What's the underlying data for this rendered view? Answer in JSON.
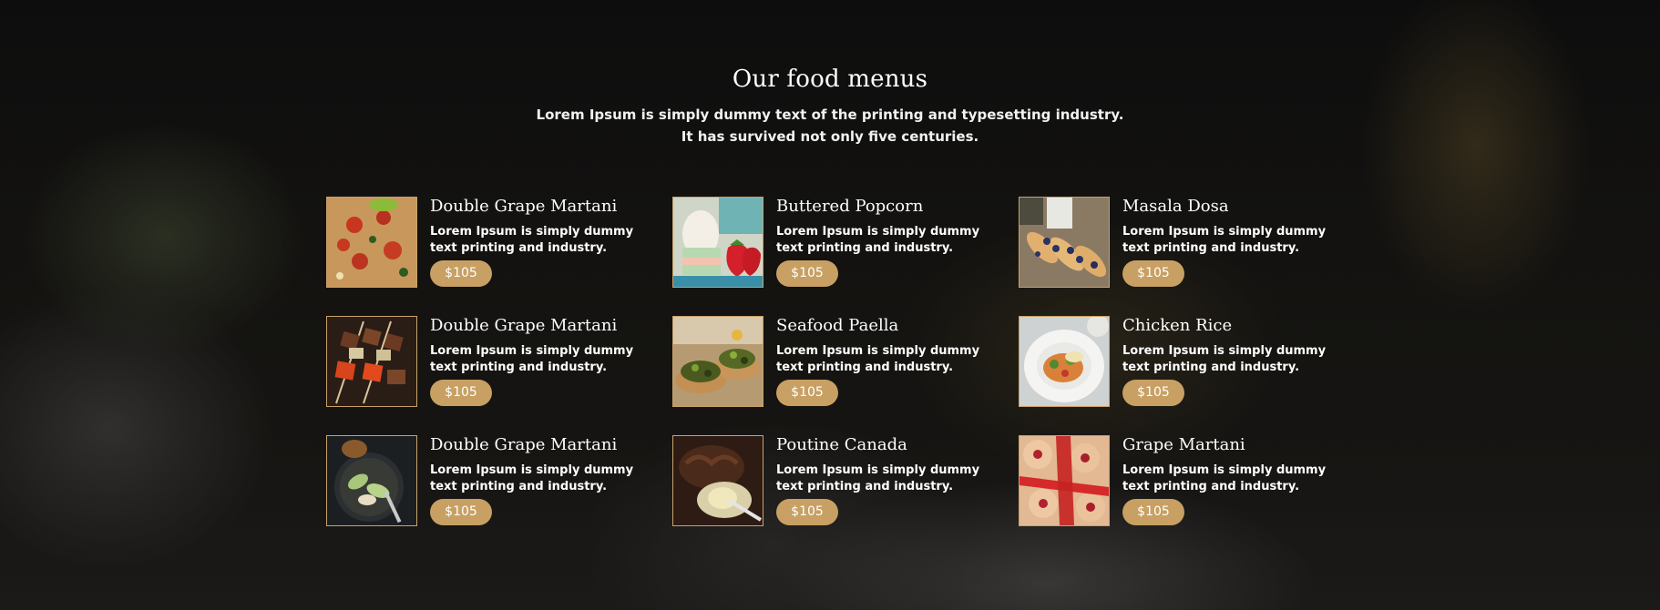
{
  "section": {
    "title": "Our food menus",
    "subtitle_line1": "Lorem Ipsum is simply dummy text of the printing and typesetting industry.",
    "subtitle_line2": "It has survived not only five centuries."
  },
  "colors": {
    "accent": "#c8a063",
    "thumb_border": "#c9a26b"
  },
  "menu_items": [
    {
      "name": "Double Grape Martani",
      "desc_line1": "Lorem Ipsum is simply dummy",
      "desc_line2": "text printing and industry.",
      "price": "$105",
      "image": "pizza-image"
    },
    {
      "name": "Buttered Popcorn",
      "desc_line1": "Lorem Ipsum is simply dummy",
      "desc_line2": "text printing and industry.",
      "price": "$105",
      "image": "strawberries-egg-image"
    },
    {
      "name": "Masala Dosa",
      "desc_line1": "Lorem Ipsum is simply dummy",
      "desc_line2": "text printing and industry.",
      "price": "$105",
      "image": "crepes-blueberries-image"
    },
    {
      "name": "Double Grape Martani",
      "desc_line1": "Lorem Ipsum is simply dummy",
      "desc_line2": "text printing and industry.",
      "price": "$105",
      "image": "kebab-skewers-image"
    },
    {
      "name": "Seafood Paella",
      "desc_line1": "Lorem Ipsum is simply dummy",
      "desc_line2": "text printing and industry.",
      "price": "$105",
      "image": "stuffed-mushrooms-image"
    },
    {
      "name": "Chicken Rice",
      "desc_line1": "Lorem Ipsum is simply dummy",
      "desc_line2": "text printing and industry.",
      "price": "$105",
      "image": "rice-plate-image"
    },
    {
      "name": "Double Grape Martani",
      "desc_line1": "Lorem Ipsum is simply dummy",
      "desc_line2": "text printing and industry.",
      "price": "$105",
      "image": "skillet-vegetables-image"
    },
    {
      "name": "Poutine Canada",
      "desc_line1": "Lorem Ipsum is simply dummy",
      "desc_line2": "text printing and industry.",
      "price": "$105",
      "image": "chocolate-dessert-image"
    },
    {
      "name": "Grape Martani",
      "desc_line1": "Lorem Ipsum is simply dummy",
      "desc_line2": "text printing and industry.",
      "price": "$105",
      "image": "jam-cookies-image"
    }
  ]
}
